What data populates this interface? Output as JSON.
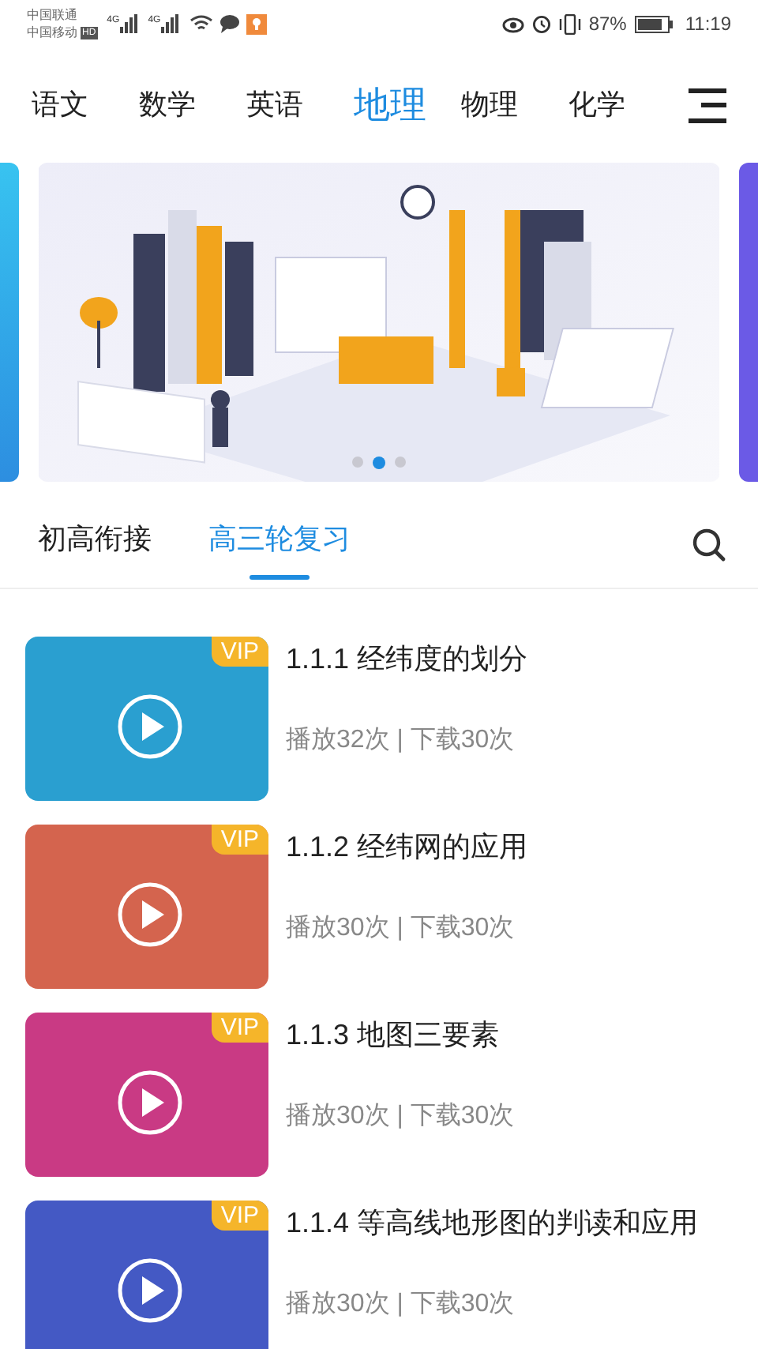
{
  "status_bar": {
    "carriers": [
      "中国联通",
      "中国移动"
    ],
    "hd": "HD",
    "networks": [
      "4G",
      "4G"
    ],
    "battery": "87%",
    "time": "11:19"
  },
  "subject_tabs": [
    {
      "label": "语文",
      "selected": false
    },
    {
      "label": "数学",
      "selected": false
    },
    {
      "label": "英语",
      "selected": false
    },
    {
      "label": "地理",
      "selected": true
    },
    {
      "label": "物理",
      "selected": false
    },
    {
      "label": "化学",
      "selected": false
    }
  ],
  "banner": {
    "dots": [
      {
        "selected": false
      },
      {
        "selected": true
      },
      {
        "selected": false
      }
    ]
  },
  "section_tabs": [
    {
      "label": "初高衔接",
      "selected": false
    },
    {
      "label": "高三轮复习",
      "selected": true
    }
  ],
  "lessons": [
    {
      "title": "1.1.1 经纬度的划分",
      "stats": "播放32次 | 下载30次",
      "badge": "VIP",
      "color": "#2a9fd0"
    },
    {
      "title": "1.1.2 经纬网的应用",
      "stats": "播放30次 | 下载30次",
      "badge": "VIP",
      "color": "#d4644e"
    },
    {
      "title": "1.1.3 地图三要素",
      "stats": "播放30次 | 下载30次",
      "badge": "VIP",
      "color": "#c93a84"
    },
    {
      "title": "1.1.4 等高线地形图的判读和应用",
      "stats": "播放30次 | 下载30次",
      "badge": "VIP",
      "color": "#4459c4"
    }
  ]
}
